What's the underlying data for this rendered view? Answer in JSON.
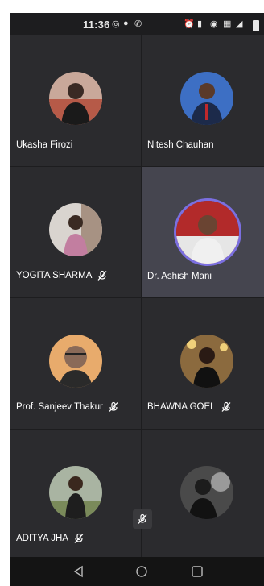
{
  "status_bar": {
    "time": "11:36",
    "icons": [
      "whatsapp-icon",
      "mic-icon",
      "call-icon",
      "alarm-icon",
      "vibrate-icon",
      "hotspot-icon",
      "data-icon",
      "signal-icon",
      "battery-icon"
    ]
  },
  "participants": [
    {
      "name": "Ukasha Firozi",
      "muted": false,
      "active": false
    },
    {
      "name": "Nitesh Chauhan",
      "muted": false,
      "active": false
    },
    {
      "name": "YOGITA SHARMA",
      "muted": true,
      "active": false
    },
    {
      "name": "Dr. Ashish Mani",
      "muted": false,
      "active": true
    },
    {
      "name": "Prof. Sanjeev Thakur",
      "muted": true,
      "active": false
    },
    {
      "name": "BHAWNA GOEL",
      "muted": true,
      "active": false
    },
    {
      "name": "ADITYA JHA",
      "muted": true,
      "active": false
    },
    {
      "name": "",
      "muted": false,
      "active": false
    }
  ],
  "self_view": {
    "muted": true,
    "icon": "mic-off-icon"
  },
  "nav_bar": {
    "buttons": [
      "back-icon",
      "home-icon",
      "recents-icon"
    ]
  },
  "colors": {
    "tile": "#2b2b2e",
    "active_tile": "#45454f",
    "ring": "#7b6fe0"
  }
}
